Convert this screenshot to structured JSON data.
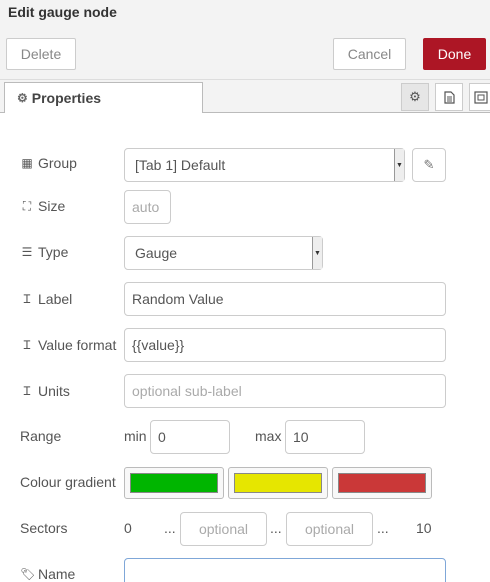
{
  "dialog": {
    "title": "Edit gauge node"
  },
  "buttons": {
    "delete": "Delete",
    "cancel": "Cancel",
    "done": "Done"
  },
  "tabs": {
    "properties": "Properties"
  },
  "icons": {
    "tab_settings": "gear-icon",
    "tab_description": "document-icon",
    "tab_appearance": "frame-icon"
  },
  "fields": {
    "group": {
      "label": "Group",
      "value": "[Tab 1] Default"
    },
    "size": {
      "label": "Size",
      "value": "auto"
    },
    "type": {
      "label": "Type",
      "value": "Gauge"
    },
    "label": {
      "label": "Label",
      "value": "Random Value"
    },
    "value_format": {
      "label": "Value format",
      "value": "{{value}}"
    },
    "units": {
      "label": "Units",
      "placeholder": "optional sub-label"
    },
    "range": {
      "label": "Range",
      "min_label": "min",
      "min_value": "0",
      "max_label": "max",
      "max_value": "10"
    },
    "colour_gradient": {
      "label": "Colour gradient",
      "colors": [
        "#00b500",
        "#e6e600",
        "#ca3838"
      ]
    },
    "sectors": {
      "label": "Sectors",
      "start": "0",
      "sep": "...",
      "placeholder1": "optional",
      "placeholder2": "optional",
      "end": "10"
    },
    "name": {
      "label": "Name",
      "value": ""
    }
  }
}
